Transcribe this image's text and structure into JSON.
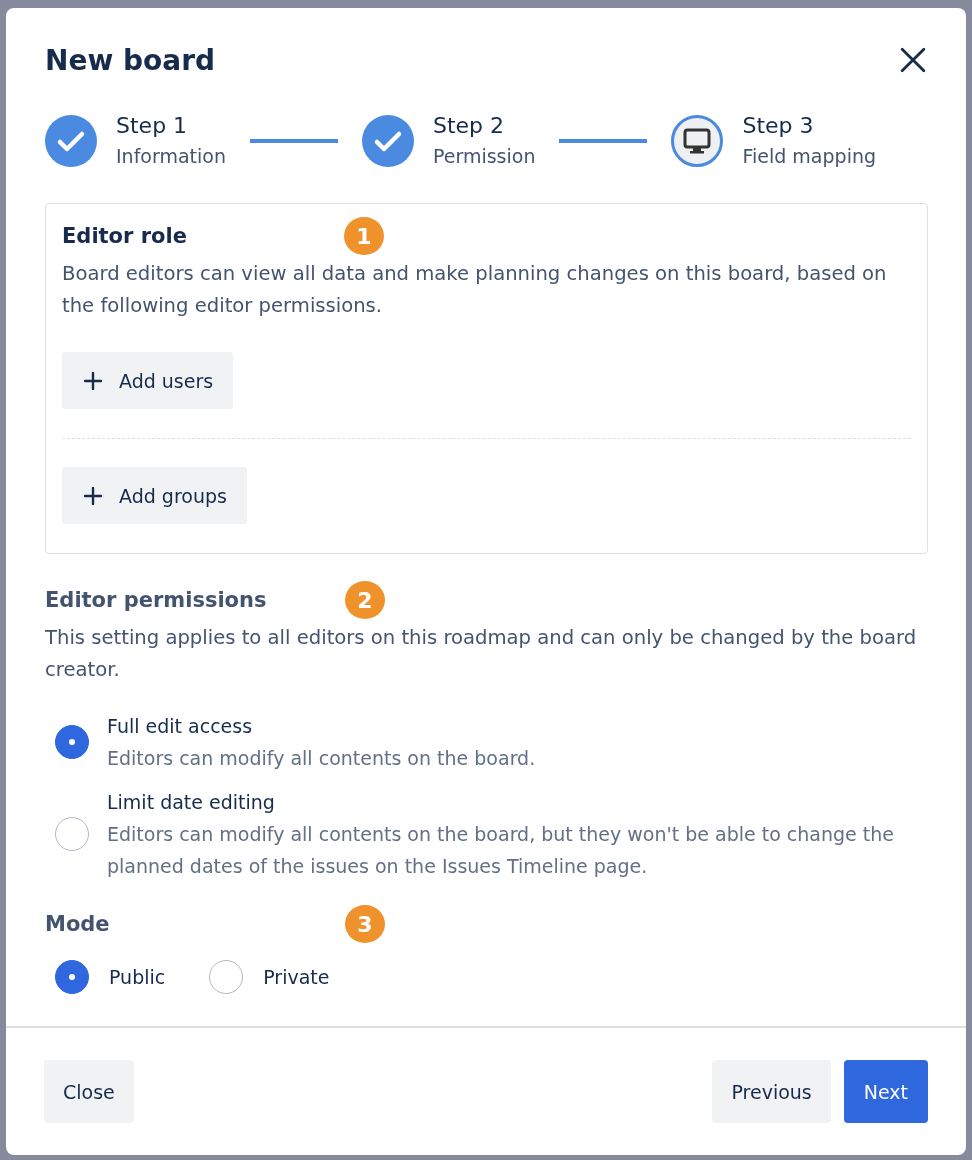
{
  "dialog": {
    "title": "New board"
  },
  "steps": [
    {
      "label": "Step 1",
      "caption": "Information",
      "completed": true
    },
    {
      "label": "Step 2",
      "caption": "Permission",
      "completed": true
    },
    {
      "label": "Step 3",
      "caption": "Field mapping",
      "completed": false
    }
  ],
  "editor_role": {
    "title": "Editor role",
    "marker": "1",
    "description": "Board editors can view all data and make planning changes on this board, based on the following editor permissions.",
    "buttons": [
      "Add users",
      "Add groups"
    ]
  },
  "editor_permissions": {
    "title": "Editor permissions",
    "marker": "2",
    "description": "This setting applies to all editors on this roadmap and can only be changed by the board creator.",
    "options": [
      {
        "label": "Full edit access",
        "description": "Editors can modify all contents on the board.",
        "selected": true
      },
      {
        "label": "Limit date editing",
        "description": "Editors can modify all contents on the board, but they won't be able to change the planned dates of the issues on the Issues Timeline page.",
        "selected": false
      }
    ]
  },
  "mode": {
    "title": "Mode",
    "marker": "3",
    "options": [
      {
        "label": "Public",
        "selected": true
      },
      {
        "label": "Private",
        "selected": false
      }
    ]
  },
  "footer": {
    "left_buttons": [
      {
        "label": "Close",
        "kind": "secondary"
      }
    ],
    "right_buttons": [
      {
        "label": "Previous",
        "kind": "secondary"
      },
      {
        "label": "Next",
        "kind": "primary"
      }
    ]
  }
}
